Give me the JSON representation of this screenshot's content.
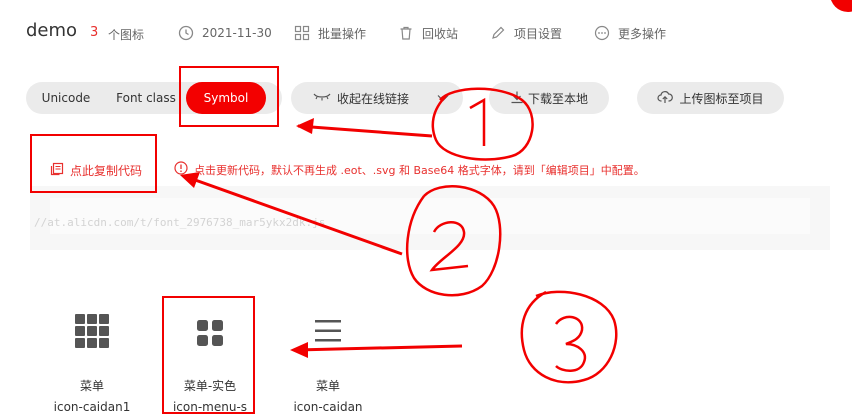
{
  "header": {
    "project_name": "demo",
    "icon_count": "3",
    "icon_count_label": "个图标",
    "date": "2021-11-30",
    "batch_ops": "批量操作",
    "recycle_bin": "回收站",
    "project_settings": "项目设置",
    "more_ops": "更多操作"
  },
  "toolbar": {
    "tabs": [
      {
        "label": "Unicode",
        "active": false
      },
      {
        "label": "Font class",
        "active": false
      },
      {
        "label": "Symbol",
        "active": true
      }
    ],
    "collapse_link": "收起在线链接",
    "download": "下载至本地",
    "upload": "上传图标至项目"
  },
  "code_area": {
    "copy_code": "点此复制代码",
    "notice": "点击更新代码，默认不再生成 .eot、.svg 和 Base64 格式字体，请到「编辑项目」中配置。",
    "code": "//at.alicdn.com/t/font_2976738_mar5ykx2dk.js"
  },
  "icons": [
    {
      "name": "菜单",
      "code": "icon-caidan1",
      "glyph": "grid-nine-icon"
    },
    {
      "name": "菜单-实色",
      "code": "icon-menu-s",
      "glyph": "grid-four-icon"
    },
    {
      "name": "菜单",
      "code": "icon-caidan",
      "glyph": "hamburger-icon"
    }
  ],
  "annotations": [
    "1",
    "2",
    "3"
  ],
  "colors": {
    "accent": "#f30000",
    "annotation": "#f20000",
    "pill_bg": "#ebebeb"
  }
}
